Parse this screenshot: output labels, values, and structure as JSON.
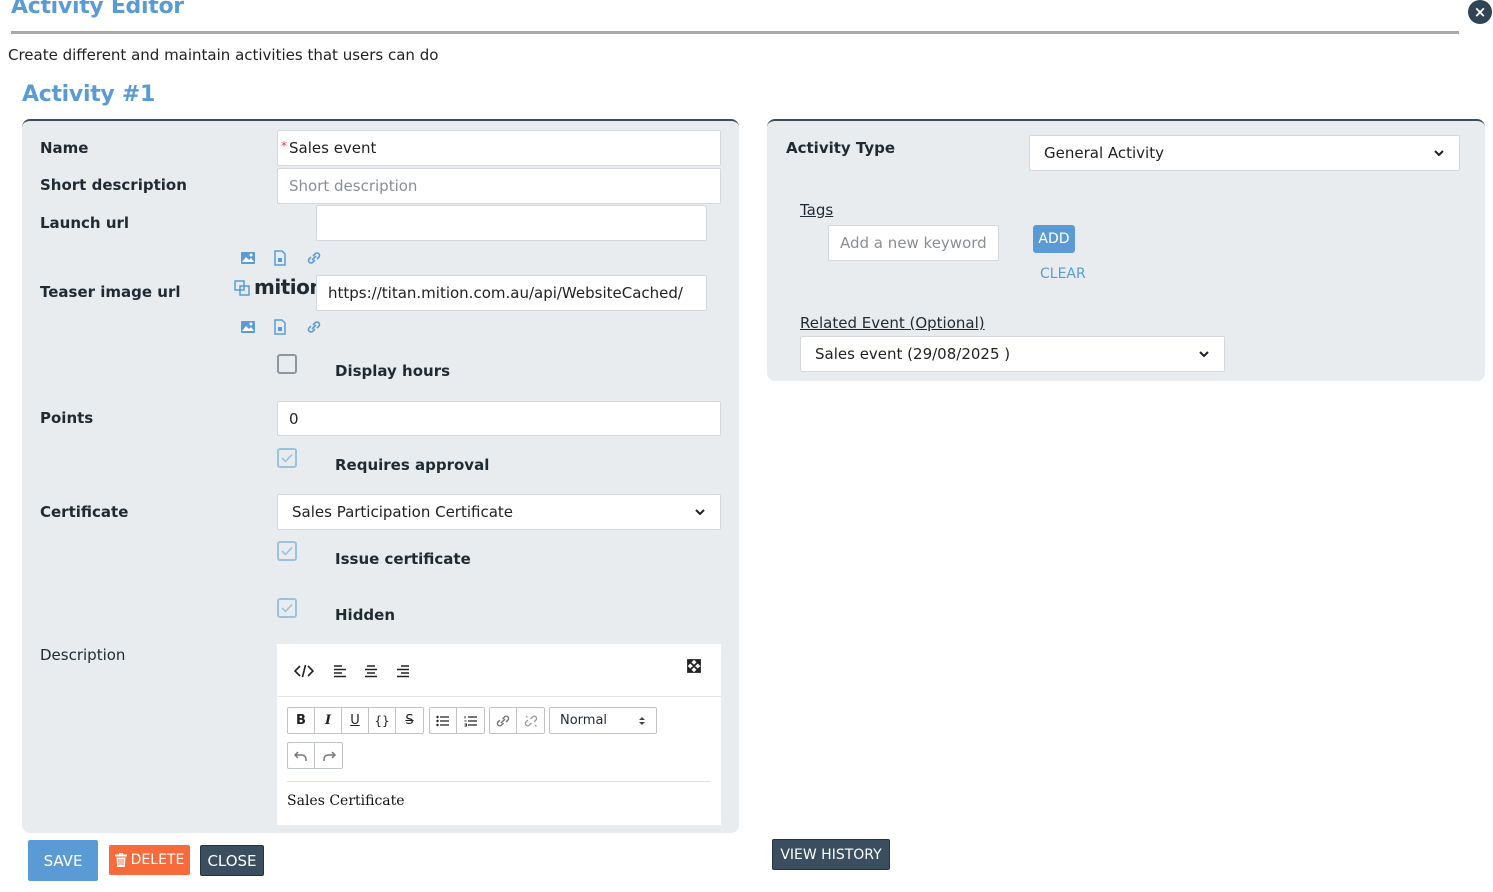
{
  "window": {
    "title": "Activity Editor",
    "subtitle": "Create different and maintain activities that users can do",
    "close_glyph": "×"
  },
  "activity": {
    "heading": "Activity #1"
  },
  "form": {
    "name_label": "Name",
    "name_value": "Sales event",
    "name_required_mark": "*",
    "short_desc_label": "Short description",
    "short_desc_placeholder": "Short description",
    "launch_url_label": "Launch url",
    "launch_url_value": "",
    "teaser_label": "Teaser image url",
    "teaser_value": "https://titan.mition.com.au/api/WebsiteCached/",
    "mition_brand": "mition",
    "display_hours_label": "Display hours",
    "display_hours_checked": false,
    "points_label": "Points",
    "points_value": "0",
    "requires_approval_label": "Requires approval",
    "requires_approval_checked": true,
    "certificate_label": "Certificate",
    "certificate_value": "Sales Participation Certificate",
    "issue_certificate_label": "Issue certificate",
    "issue_certificate_checked": true,
    "hidden_label": "Hidden",
    "hidden_checked": true,
    "description_label": "Description"
  },
  "editor": {
    "format_value": "Normal",
    "content": "Sales Certificate"
  },
  "right": {
    "activity_type_label": "Activity Type",
    "activity_type_value": "General Activity",
    "tags_label": "Tags",
    "tags_placeholder": "Add a new keyword",
    "add_label": "ADD",
    "clear_label": "CLEAR",
    "related_event_label": "Related Event (Optional)",
    "related_event_value": "Sales event (29/08/2025 )"
  },
  "buttons": {
    "save": "SAVE",
    "delete": "DELETE",
    "close": "CLOSE",
    "view_history": "VIEW HISTORY"
  },
  "colors": {
    "accent": "#5b9bd5",
    "dark": "#3a4e60",
    "danger": "#f56b3c",
    "panel": "#e8ecef"
  }
}
